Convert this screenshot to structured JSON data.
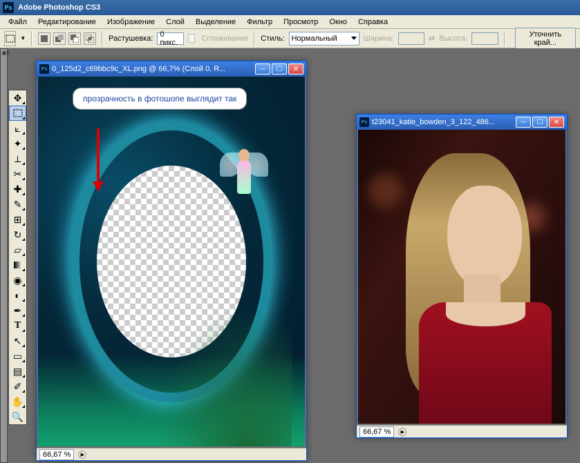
{
  "app": {
    "title": "Adobe Photoshop CS3"
  },
  "menus": [
    "Файл",
    "Редактирование",
    "Изображение",
    "Слой",
    "Выделение",
    "Фильтр",
    "Просмотр",
    "Окно",
    "Справка"
  ],
  "options": {
    "feather_label": "Растушевка:",
    "feather_value": "0 пикс.",
    "antialias_label": "Сглаживание",
    "style_label": "Стиль:",
    "style_value": "Нормальный",
    "width_label": "Ширина:",
    "height_label": "Высота:",
    "refine_label": "Уточнить край..."
  },
  "doc1": {
    "title": "0_125d2_c69bbc9c_XL.png @ 66,7% (Слой 0, R...",
    "zoom": "66,67 %",
    "callout": "прозрачность в фотошопе выглядит так"
  },
  "doc2": {
    "title": "t23041_katie_bowden_3_122_486...",
    "zoom": "66,67 %"
  },
  "tool_names": [
    "move",
    "marquee",
    "lasso",
    "magic-wand",
    "crop",
    "slice",
    "healing",
    "brush",
    "stamp",
    "history-brush",
    "eraser",
    "gradient",
    "blur",
    "dodge",
    "pen",
    "type",
    "path-select",
    "shape",
    "notes",
    "eyedropper",
    "hand",
    "zoom"
  ]
}
